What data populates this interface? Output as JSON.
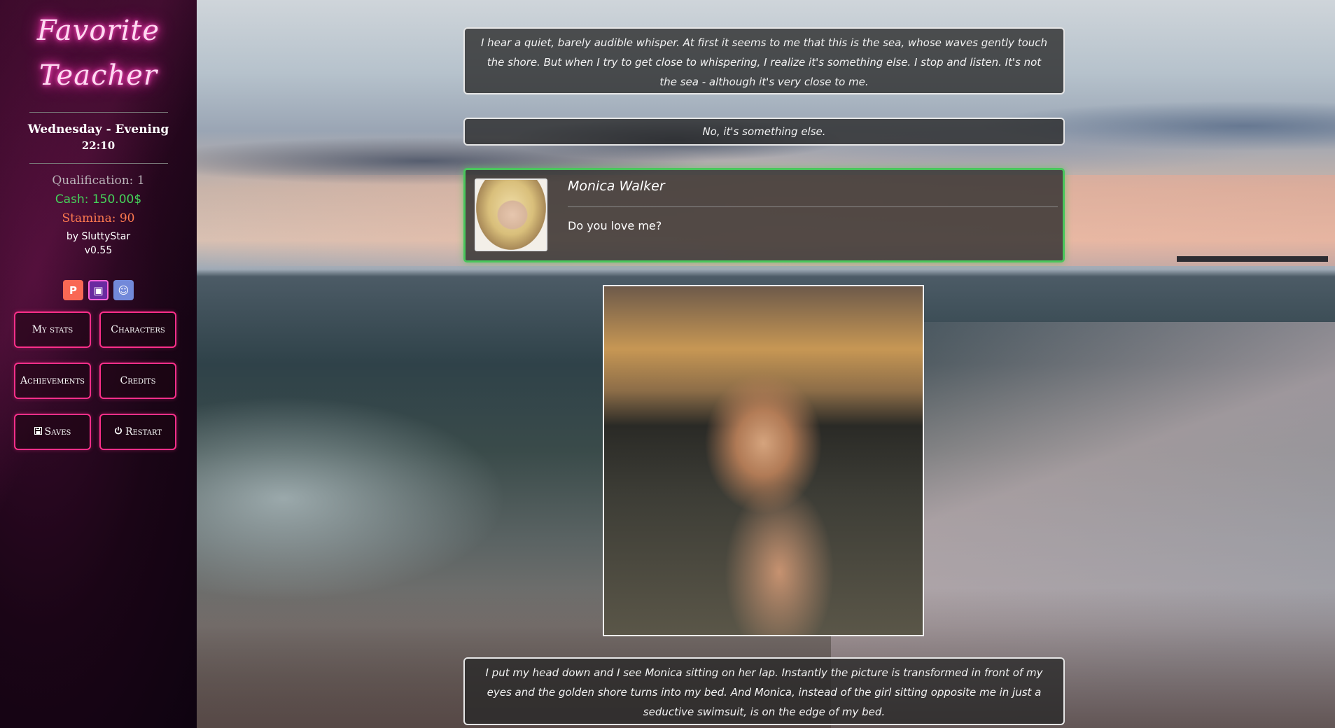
{
  "sidebar": {
    "logo_line1": "Favorite",
    "logo_line2": "Teacher",
    "day_period": "Wednesday - Evening",
    "time": "22:10",
    "qualification": "Qualification: 1",
    "cash": "Cash: 150.00$",
    "stamina": "Stamina: 90",
    "author": "by SluttyStar",
    "version": "v0.55",
    "social": [
      {
        "icon": "patreon-icon",
        "glyph": "P"
      },
      {
        "icon": "itch-icon",
        "glyph": "▣"
      },
      {
        "icon": "discord-icon",
        "glyph": "☺"
      }
    ],
    "buttons": {
      "my_stats": "My stats",
      "characters": "Characters",
      "achievements": "Achievements",
      "credits": "Credits",
      "saves": "Saves",
      "restart": "Restart"
    },
    "colors": {
      "accent": "#ff2f8a",
      "cash": "#45d35a",
      "stamina": "#ff7a4f"
    }
  },
  "story": {
    "paragraph1": "I hear a quiet, barely audible whisper. At first it seems to me that this is the sea, whose waves gently touch the shore. But when I try to get close to whispering, I realize it's something else. I stop and listen. It's not the sea - although it's very close to me.",
    "paragraph2": "No, it's something else.",
    "dialog": {
      "speaker": "Monica Walker",
      "text": "Do you love me?",
      "border_color": "#49c65b"
    },
    "paragraph3": "I put my head down and I see Monica sitting on her lap. Instantly the picture is transformed in front of my eyes and the golden shore turns into my bed. And Monica, instead of the girl sitting opposite me in just a seductive swimsuit, is on the edge of my bed."
  }
}
